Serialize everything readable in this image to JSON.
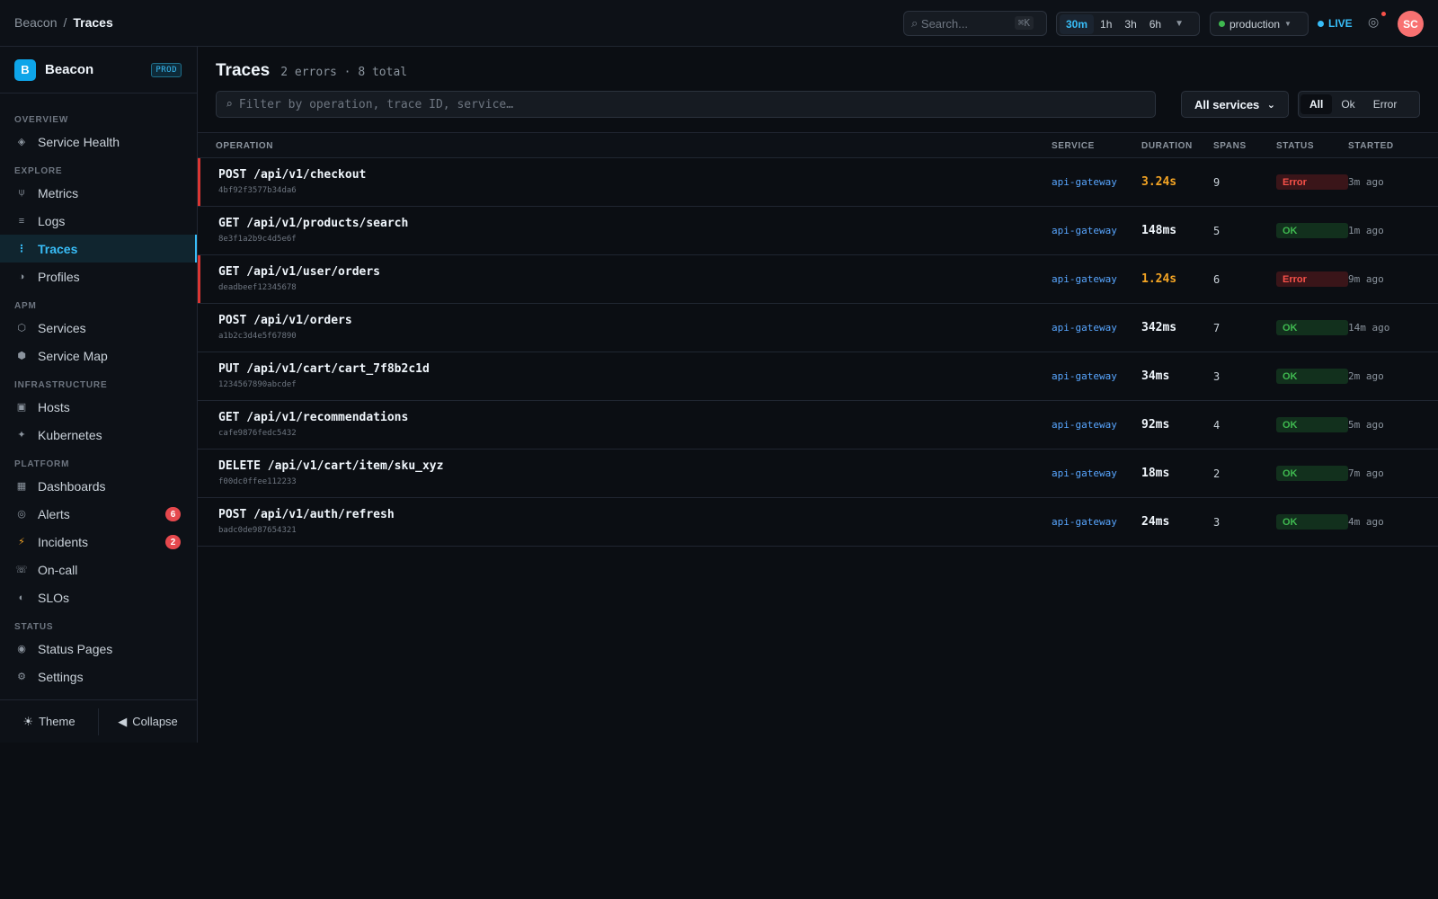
{
  "topbar": {
    "breadcrumb_root": "Beacon",
    "breadcrumb_sep": "/",
    "breadcrumb_current": "Traces",
    "search_placeholder": "Search...",
    "search_shortcut": "⌘K",
    "time_ranges": [
      "30m",
      "1h",
      "3h",
      "6h"
    ],
    "time_active": "30m",
    "environment": "production",
    "live_label": "LIVE",
    "avatar_initials": "SC"
  },
  "sidebar": {
    "brand_letter": "B",
    "brand_name": "Beacon",
    "brand_badge": "PROD",
    "sections": [
      {
        "title": "OVERVIEW",
        "items": [
          {
            "label": "Service Health",
            "icon": "pulse-icon"
          }
        ]
      },
      {
        "title": "EXPLORE",
        "items": [
          {
            "label": "Metrics",
            "icon": "metrics-icon"
          },
          {
            "label": "Logs",
            "icon": "logs-icon"
          },
          {
            "label": "Traces",
            "icon": "traces-icon",
            "active": true
          },
          {
            "label": "Profiles",
            "icon": "profiles-icon"
          }
        ]
      },
      {
        "title": "APM",
        "items": [
          {
            "label": "Services",
            "icon": "services-icon"
          },
          {
            "label": "Service Map",
            "icon": "service-map-icon"
          }
        ]
      },
      {
        "title": "INFRASTRUCTURE",
        "items": [
          {
            "label": "Hosts",
            "icon": "hosts-icon"
          },
          {
            "label": "Kubernetes",
            "icon": "kubernetes-icon"
          }
        ]
      },
      {
        "title": "PLATFORM",
        "items": [
          {
            "label": "Dashboards",
            "icon": "dashboards-icon"
          },
          {
            "label": "Alerts",
            "icon": "alerts-icon",
            "count": "6"
          },
          {
            "label": "Incidents",
            "icon": "incidents-icon",
            "count": "2"
          },
          {
            "label": "On-call",
            "icon": "oncall-icon"
          },
          {
            "label": "SLOs",
            "icon": "slos-icon"
          }
        ]
      },
      {
        "title": "STATUS",
        "items": [
          {
            "label": "Status Pages",
            "icon": "status-pages-icon"
          },
          {
            "label": "Settings",
            "icon": "settings-icon"
          }
        ]
      }
    ],
    "footer_theme": "Theme",
    "footer_collapse": "Collapse"
  },
  "main": {
    "title": "Traces",
    "subtitle": "2 errors · 8 total",
    "filter_placeholder": "Filter by operation, trace ID, service…",
    "service_select": "All services",
    "status_filters": [
      "All",
      "Ok",
      "Error"
    ],
    "status_filter_active": "All",
    "columns": {
      "operation": "OPERATION",
      "service": "SERVICE",
      "duration": "DURATION",
      "spans": "SPANS",
      "status": "STATUS",
      "started": "STARTED"
    },
    "rows": [
      {
        "operation": "POST /api/v1/checkout",
        "trace_id": "4bf92f3577b34da6",
        "service": "api-gateway",
        "duration": "3.24s",
        "slow": true,
        "spans": "9",
        "status": "Error",
        "started": "3m ago"
      },
      {
        "operation": "GET /api/v1/products/search",
        "trace_id": "8e3f1a2b9c4d5e6f",
        "service": "api-gateway",
        "duration": "148ms",
        "slow": false,
        "spans": "5",
        "status": "OK",
        "started": "1m ago"
      },
      {
        "operation": "GET /api/v1/user/orders",
        "trace_id": "deadbeef12345678",
        "service": "api-gateway",
        "duration": "1.24s",
        "slow": true,
        "spans": "6",
        "status": "Error",
        "started": "9m ago"
      },
      {
        "operation": "POST /api/v1/orders",
        "trace_id": "a1b2c3d4e5f67890",
        "service": "api-gateway",
        "duration": "342ms",
        "slow": false,
        "spans": "7",
        "status": "OK",
        "started": "14m ago"
      },
      {
        "operation": "PUT /api/v1/cart/cart_7f8b2c1d",
        "trace_id": "1234567890abcdef",
        "service": "api-gateway",
        "duration": "34ms",
        "slow": false,
        "spans": "3",
        "status": "OK",
        "started": "2m ago"
      },
      {
        "operation": "GET /api/v1/recommendations",
        "trace_id": "cafe9876fedc5432",
        "service": "api-gateway",
        "duration": "92ms",
        "slow": false,
        "spans": "4",
        "status": "OK",
        "started": "5m ago"
      },
      {
        "operation": "DELETE /api/v1/cart/item/sku_xyz",
        "trace_id": "f00dc0ffee112233",
        "service": "api-gateway",
        "duration": "18ms",
        "slow": false,
        "spans": "2",
        "status": "OK",
        "started": "7m ago"
      },
      {
        "operation": "POST /api/v1/auth/refresh",
        "trace_id": "badc0de987654321",
        "service": "api-gateway",
        "duration": "24ms",
        "slow": false,
        "spans": "3",
        "status": "OK",
        "started": "4m ago"
      }
    ]
  },
  "colors": {
    "accent": "#38bdf8",
    "error": "#f85149",
    "ok": "#3fb950",
    "slow": "#f5a524",
    "background": "#0b0e13"
  }
}
